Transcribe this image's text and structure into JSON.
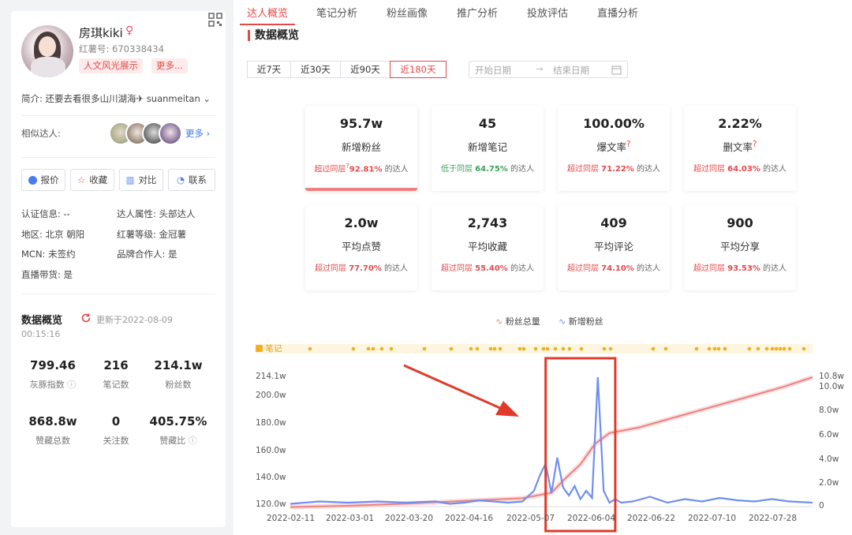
{
  "profile": {
    "name": "房琪kiki",
    "red_id": "红薯号: 670338434",
    "tags": [
      "人文风光展示",
      "更多..."
    ],
    "intro": "简介: 还要去看很多山川湖海✈ suanmeitan",
    "similar_label": "相似达人:",
    "similar_more": "更多",
    "buttons": [
      "报价",
      "收藏",
      "对比",
      "联系"
    ],
    "info": [
      {
        "k": "认证信息: ",
        "v": "--"
      },
      {
        "k": "达人属性: ",
        "v": "头部达人"
      },
      {
        "k": "地区: ",
        "v": "北京 朝阳"
      },
      {
        "k": "红薯等级: ",
        "v": "金冠薯"
      },
      {
        "k": "MCN: ",
        "v": "未签约"
      },
      {
        "k": "品牌合作人: ",
        "v": "是"
      },
      {
        "k": "直播带货: ",
        "v": "是"
      }
    ],
    "overview_title": "数据概览",
    "updated": "更新于2022-08-09",
    "updated_time": "00:15:16",
    "stats": [
      {
        "v": "799.46",
        "l": "灰豚指数"
      },
      {
        "v": "216",
        "l": "笔记数"
      },
      {
        "v": "214.1w",
        "l": "粉丝数"
      },
      {
        "v": "868.8w",
        "l": "赞藏总数"
      },
      {
        "v": "0",
        "l": "关注数"
      },
      {
        "v": "405.75%",
        "l": "赞藏比"
      }
    ]
  },
  "tabs": [
    "达人概览",
    "笔记分析",
    "粉丝画像",
    "推广分析",
    "投放评估",
    "直播分析"
  ],
  "section_title": "数据概览",
  "ranges": [
    "近7天",
    "近30天",
    "近90天",
    "近180天"
  ],
  "date_start": "开始日期",
  "date_end": "结束日期",
  "cards": [
    {
      "v": "95.7w",
      "l": "新增粉丝",
      "pre": "超过同层",
      "pct": "92.81%",
      "post": "的达人",
      "good": true
    },
    {
      "v": "45",
      "l": "新增笔记",
      "pre": "低于同层",
      "pct": "64.75%",
      "post": "的达人",
      "good": false
    },
    {
      "v": "100.00%",
      "l": "爆文率",
      "pre": "超过同层",
      "pct": "71.22%",
      "post": "的达人",
      "good": true
    },
    {
      "v": "2.22%",
      "l": "删文率",
      "pre": "超过同层",
      "pct": "64.03%",
      "post": "的达人",
      "good": true
    },
    {
      "v": "2.0w",
      "l": "平均点赞",
      "pre": "超过同层",
      "pct": "77.70%",
      "post": "的达人",
      "good": true
    },
    {
      "v": "2,743",
      "l": "平均收藏",
      "pre": "超过同层",
      "pct": "55.40%",
      "post": "的达人",
      "good": true
    },
    {
      "v": "409",
      "l": "平均评论",
      "pre": "超过同层",
      "pct": "74.10%",
      "post": "的达人",
      "good": true
    },
    {
      "v": "900",
      "l": "平均分享",
      "pre": "超过同层",
      "pct": "93.53%",
      "post": "的达人",
      "good": true
    }
  ],
  "chart_data": {
    "type": "line",
    "note_track_label": "笔记",
    "legend": [
      "粉丝总量",
      "新增粉丝"
    ],
    "x_ticks": [
      "2022-02-11",
      "2022-03-01",
      "2022-03-20",
      "2022-04-16",
      "2022-05-07",
      "2022-06-04",
      "2022-06-22",
      "2022-07-10",
      "2022-07-28"
    ],
    "y_left_ticks": [
      "120.0w",
      "140.0w",
      "160.0w",
      "180.0w",
      "200.0w",
      "214.1w"
    ],
    "y_right_ticks": [
      "0",
      "2.0w",
      "4.0w",
      "6.0w",
      "8.0w",
      "10.0w",
      "10.8w"
    ],
    "y_left_range": [
      120,
      214.1
    ],
    "y_right_range": [
      0,
      10.8
    ],
    "series": [
      {
        "name": "粉丝总量",
        "color": "#f08080",
        "x": [
          0,
          20,
          40,
          60,
          80,
          90,
          95,
          100,
          105,
          110,
          120,
          130,
          140,
          150,
          160,
          170,
          180
        ],
        "values": [
          118.5,
          119.5,
          121,
          123,
          125,
          129,
          140,
          150,
          165,
          173,
          177,
          183,
          189,
          195,
          201,
          207,
          214.1
        ]
      },
      {
        "name": "新增粉丝",
        "color": "#6f8ff0",
        "x": [
          0,
          10,
          20,
          30,
          40,
          50,
          55,
          60,
          65,
          70,
          75,
          80,
          84,
          86,
          88,
          90,
          92,
          94,
          96,
          98,
          100,
          102,
          104,
          106,
          108,
          110,
          112,
          114,
          118,
          124,
          130,
          136,
          142,
          148,
          154,
          160,
          166,
          172,
          180
        ],
        "values": [
          0.1,
          0.3,
          0.2,
          0.3,
          0.2,
          0.3,
          0.1,
          0.2,
          0.4,
          0.3,
          0.2,
          0.3,
          1.2,
          2.5,
          3.5,
          1.0,
          4.0,
          1.5,
          0.8,
          1.6,
          0.5,
          1.2,
          0.6,
          10.8,
          1.2,
          0.2,
          0.5,
          0.2,
          0.3,
          0.7,
          0.2,
          0.5,
          0.3,
          0.6,
          0.4,
          0.3,
          0.5,
          0.3,
          0.2
        ]
      }
    ],
    "highlight": {
      "x_from": 88,
      "x_to": 112
    }
  }
}
